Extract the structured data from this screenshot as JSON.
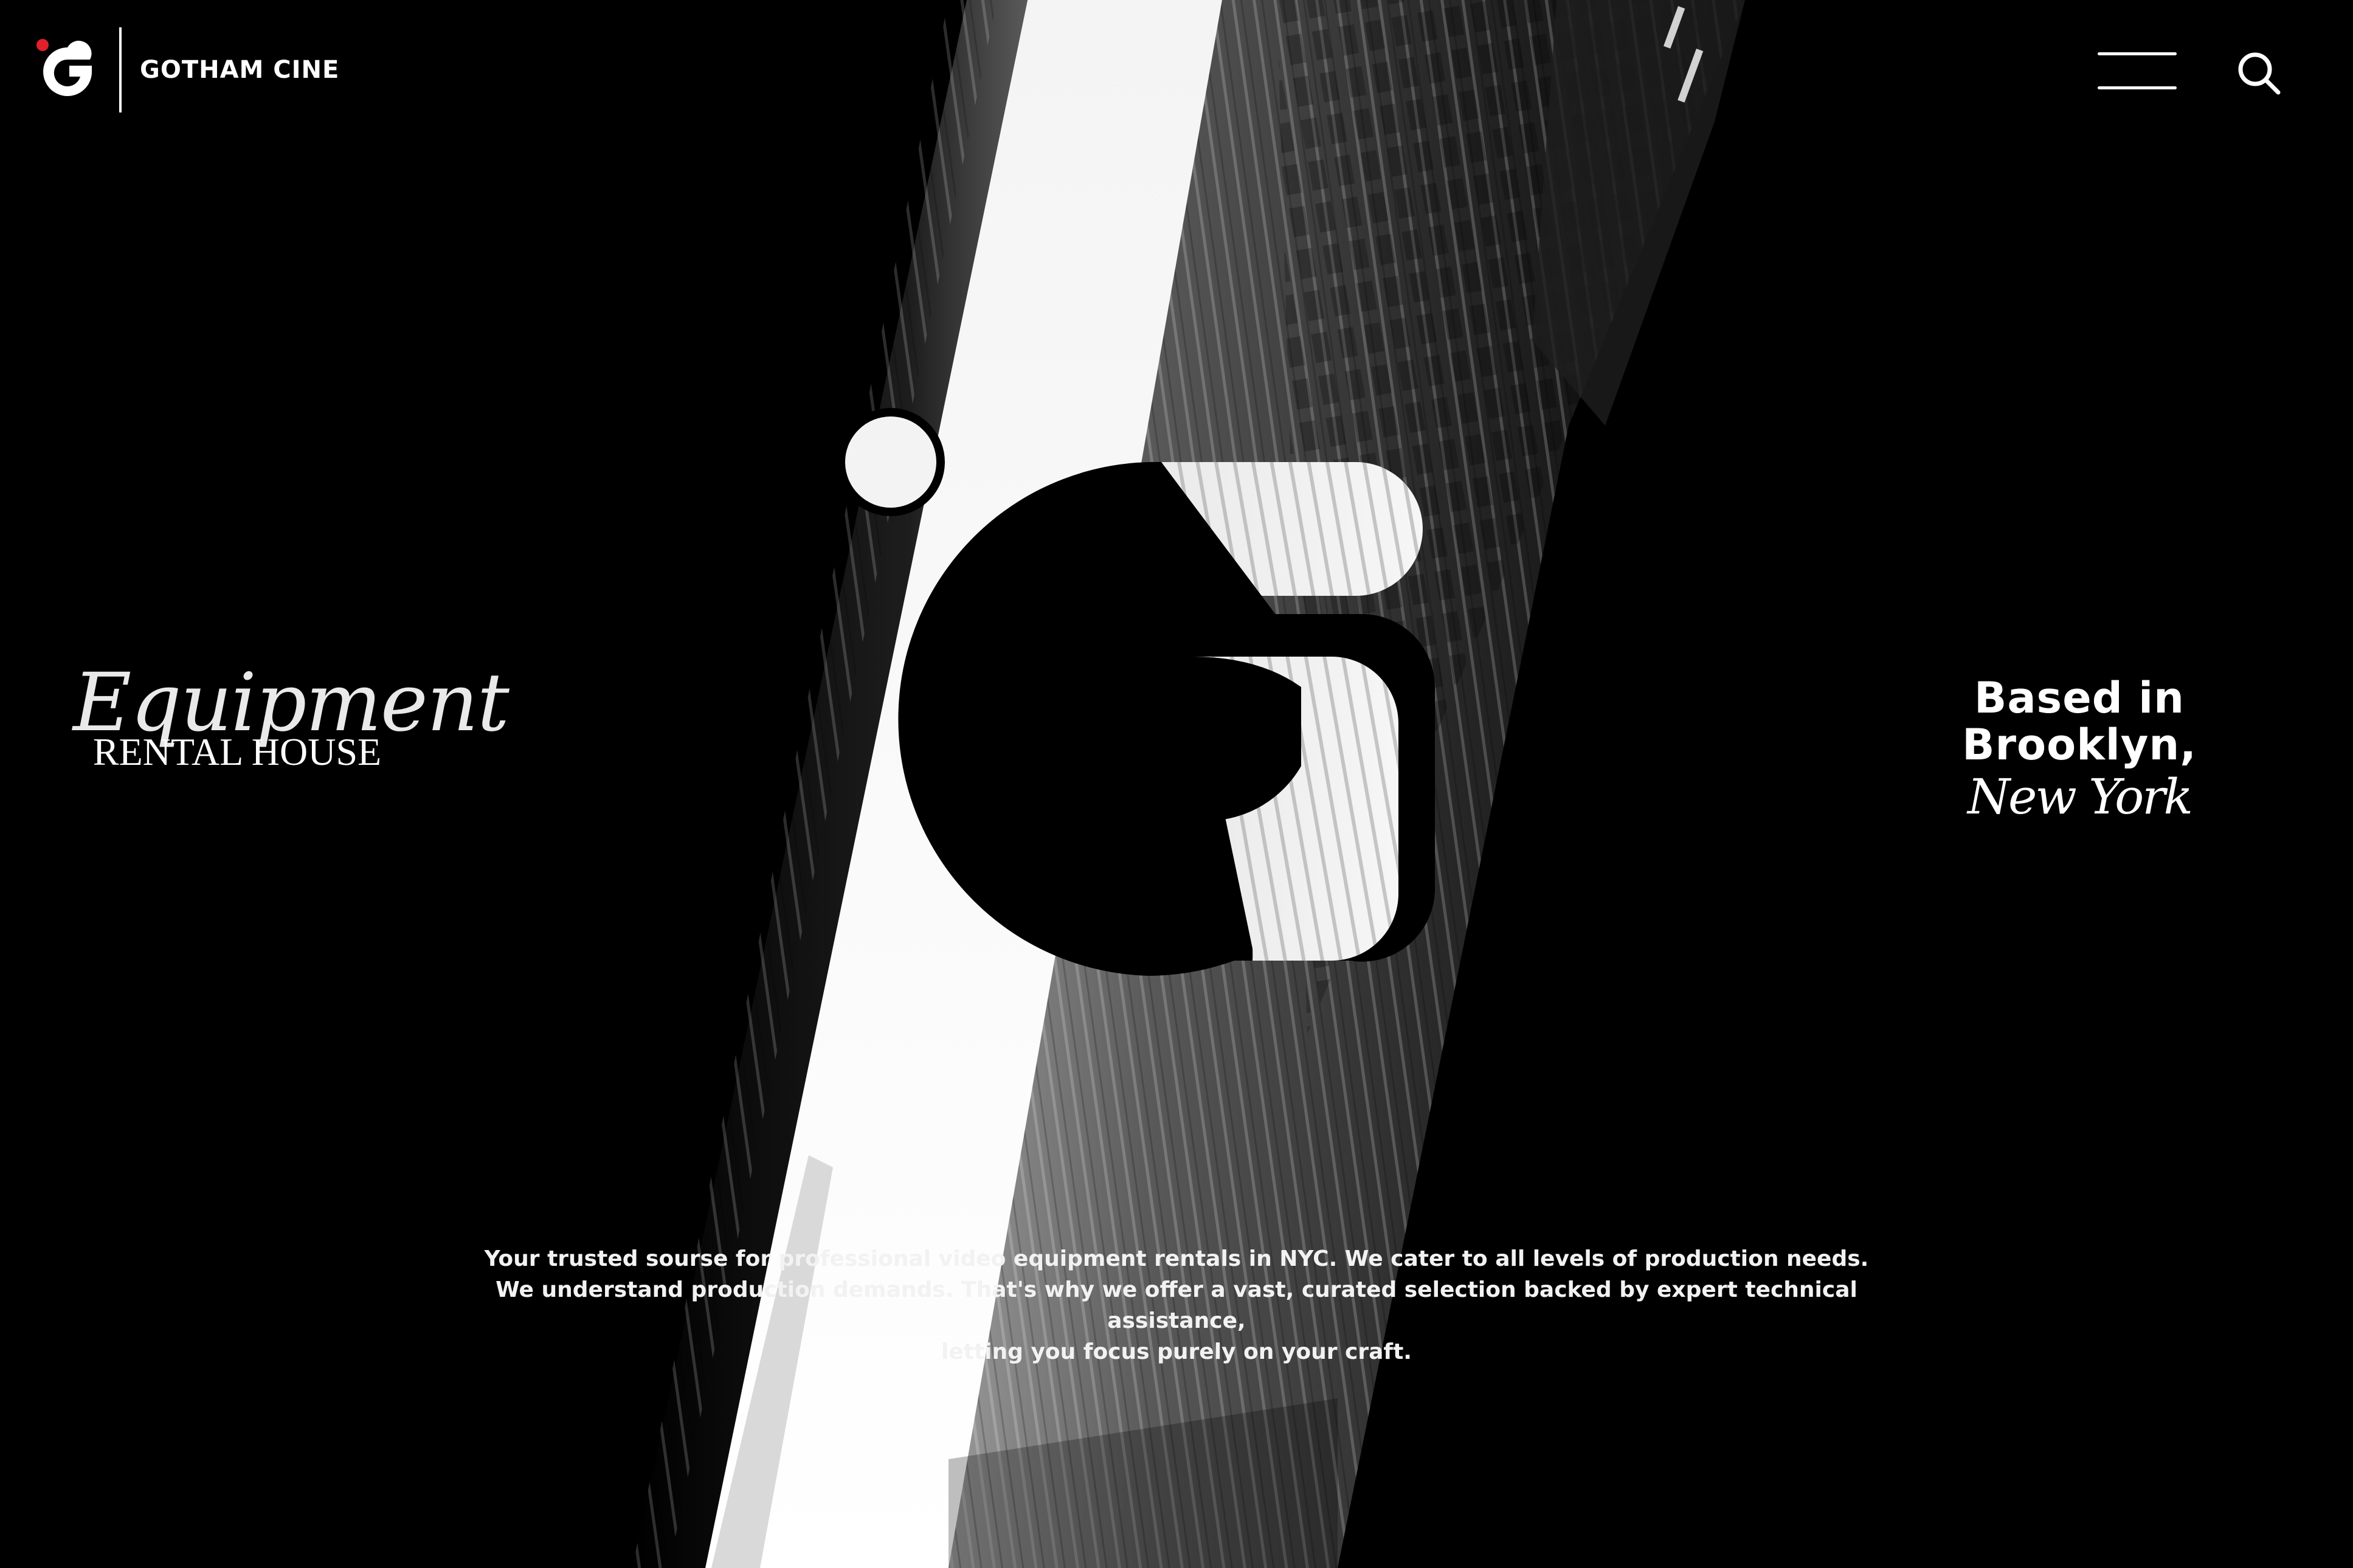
{
  "header": {
    "brand_name": "GOTHAM CINE",
    "menu_icon": "hamburger-menu-icon",
    "search_icon": "search-icon"
  },
  "hero": {
    "tagline": {
      "script": "Equipment",
      "main": "RENTAL HOUSE"
    },
    "location": {
      "main": "Based in Brooklyn,",
      "script": "New York"
    },
    "description": [
      "Your trusted sourse for professional video equipment rentals in NYC. We cater to all levels of production needs.",
      "We understand production demands. That's why we offer a vast, curated selection backed by expert technical assistance,",
      "letting you focus purely on your craft."
    ]
  },
  "colors": {
    "background": "#000000",
    "text": "#ffffff",
    "logo_accent": "#e0202a"
  }
}
